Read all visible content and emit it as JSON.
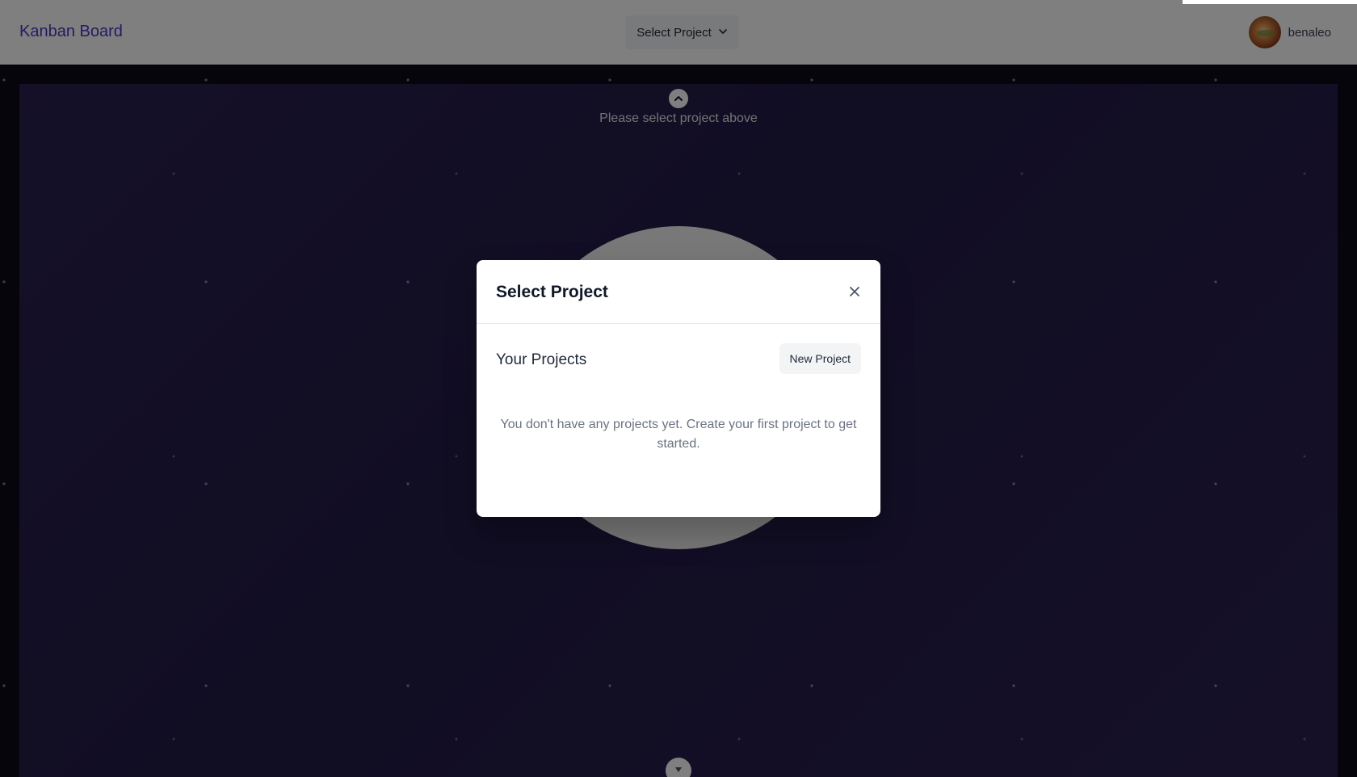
{
  "header": {
    "brand": "Kanban Board",
    "project_select_label": "Select Project",
    "username": "benaleo"
  },
  "background": {
    "hint_text": "Please select project above"
  },
  "modal": {
    "title": "Select Project",
    "section_title": "Your Projects",
    "new_project_label": "New Project",
    "empty_text": "You don't have any projects yet. Create your first project to get started."
  },
  "icons": {
    "project_select": "chevron-down-icon",
    "hint": "chevron-up-icon",
    "close": "close-icon",
    "bottom_handle": "chevron-down-icon"
  },
  "colors": {
    "brand": "#4338ca",
    "overlay": "rgba(0,0,0,0.5)",
    "board_background": "#221a46"
  }
}
